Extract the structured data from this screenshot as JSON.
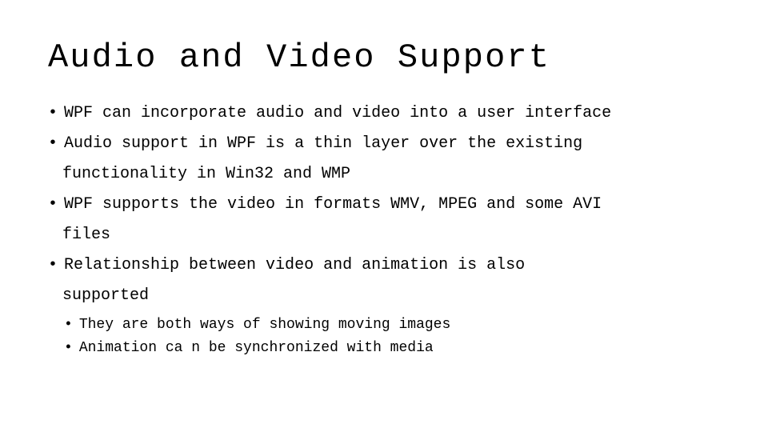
{
  "slide": {
    "title": "Audio and Video Support",
    "bullets": [
      {
        "id": "bullet-1",
        "text": "WPF can incorporate audio and video into a user interface",
        "continuation": null,
        "sub_bullets": []
      },
      {
        "id": "bullet-2",
        "text": "Audio support in WPF is a thin layer over the existing",
        "continuation": "functionality in Win32 and WMP",
        "sub_bullets": []
      },
      {
        "id": "bullet-3",
        "text": "WPF supports the video in formats WMV, MPEG and some AVI",
        "continuation": "files",
        "sub_bullets": []
      },
      {
        "id": "bullet-4",
        "text": "Relationship between video and animation is also",
        "continuation": "supported",
        "sub_bullets": [
          "They are both ways of showing moving images",
          "Animation ca n be synchronized with media"
        ]
      }
    ]
  }
}
